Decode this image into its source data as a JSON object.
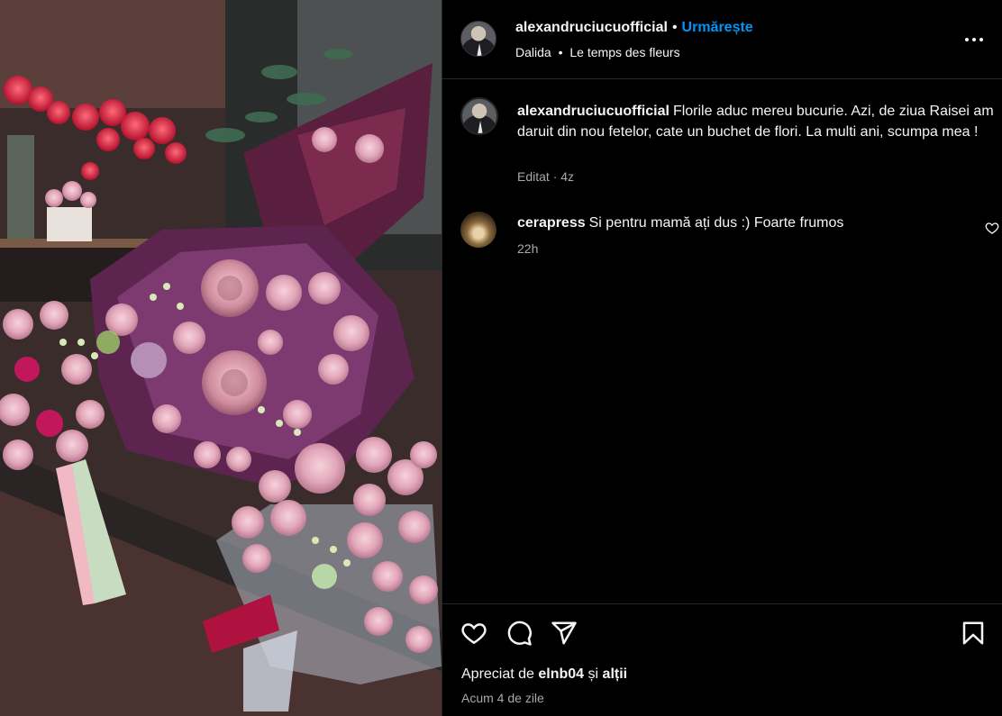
{
  "post": {
    "author": "alexandruciucuofficial",
    "follow_label": "Urmărește",
    "separator": "•",
    "audio_artist": "Dalida",
    "audio_title": "Le temps des fleurs"
  },
  "caption": {
    "author": "alexandruciucuofficial",
    "text": "Florile aduc mereu bucurie. Azi, de ziua Raisei am daruit din nou fetelor, cate un buchet de flori. La multi ani, scumpa mea !",
    "meta": "Editat · 4z"
  },
  "comments": [
    {
      "author": "cerapress",
      "text": "Si pentru mamă ați dus :) Foarte frumos",
      "time": "22h"
    }
  ],
  "actions": {
    "liked_by_prefix": "Apreciat de",
    "liked_by_user": "elnb04",
    "liked_by_conj": "și",
    "liked_by_others": "alții",
    "posted": "Acum 4 de zile"
  },
  "icons": [
    "more-options-icon",
    "heart-icon",
    "comment-icon",
    "share-icon",
    "save-icon",
    "comment-like-icon"
  ],
  "colors": {
    "accent": "#0095f6",
    "background": "#000000",
    "muted_text": "#a8a8a8",
    "divider": "#262626"
  }
}
